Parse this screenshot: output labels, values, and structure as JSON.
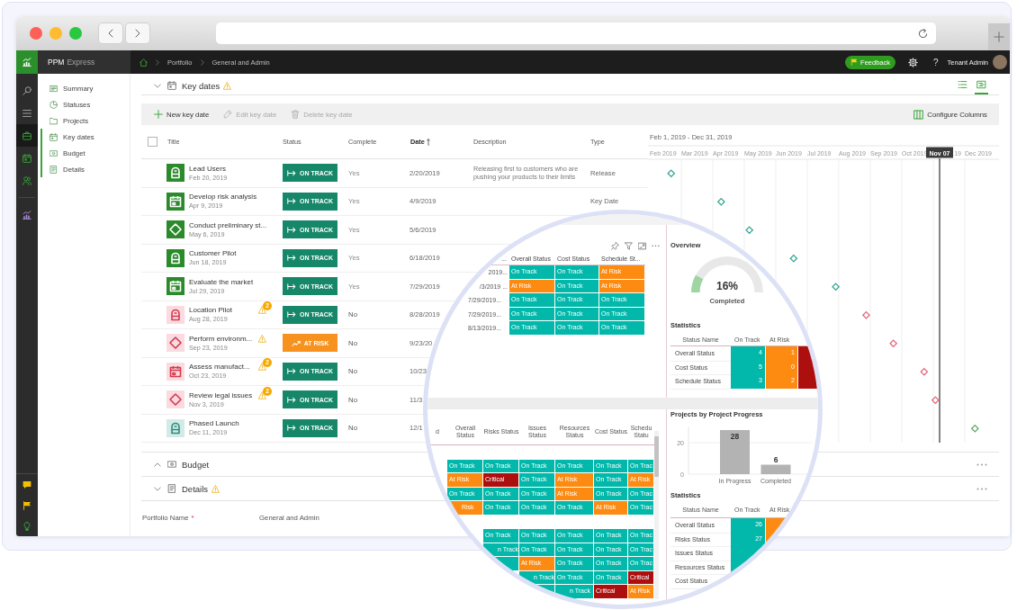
{
  "product": {
    "name": "PPM",
    "suffix": "Express"
  },
  "breadcrumb": [
    "Portfolio",
    "General and Admin"
  ],
  "header": {
    "feedback": "Feedback",
    "help": "?",
    "user": "Tenant Admin"
  },
  "rail": [
    {
      "kind": "search",
      "selected": false
    },
    {
      "kind": "menu",
      "selected": false
    },
    {
      "kind": "briefcase",
      "selected": true
    },
    {
      "kind": "calendar",
      "selected": false
    },
    {
      "kind": "person",
      "selected": false
    },
    {
      "kind": "chart",
      "selected": false
    }
  ],
  "rail_bottom": [
    {
      "kind": "chat"
    },
    {
      "kind": "flag"
    },
    {
      "kind": "bulb"
    }
  ],
  "nav": [
    {
      "kind": "summary",
      "label": "Summary",
      "in_view": false
    },
    {
      "kind": "statuses",
      "label": "Statuses",
      "in_view": false
    },
    {
      "kind": "projects",
      "label": "Projects",
      "in_view": false
    },
    {
      "kind": "keydates",
      "label": "Key dates",
      "in_view": true
    },
    {
      "kind": "budget",
      "label": "Budget",
      "in_view": true
    },
    {
      "kind": "details",
      "label": "Details",
      "in_view": true
    }
  ],
  "key_dates": {
    "title": "Key dates",
    "expanded": true,
    "warning": true,
    "views": [
      {
        "kind": "list",
        "selected": false
      },
      {
        "kind": "timeline",
        "selected": true
      }
    ],
    "toolbar": [
      {
        "kind": "add",
        "label": "New key date",
        "disabled": false
      },
      {
        "kind": "edit",
        "label": "Edit key date",
        "disabled": true
      },
      {
        "kind": "delete",
        "label": "Delete key date",
        "disabled": true
      }
    ],
    "configure": "Configure Columns",
    "select_all": {
      "checked": false
    },
    "columns": [
      {
        "label": "Title",
        "sorted": false
      },
      {
        "label": "Status",
        "sorted": false
      },
      {
        "label": "Complete",
        "sorted": false
      },
      {
        "label": "Date",
        "sorted": true
      },
      {
        "label": "Description",
        "sorted": false
      },
      {
        "label": "Type",
        "sorted": false
      }
    ],
    "rows": [
      {
        "kind": "gate",
        "done": true,
        "overdue": false,
        "title": "Lead Users",
        "subtitle": "Feb 20, 2019",
        "warning": false,
        "status": {
          "kind": "on_track",
          "label": "ON TRACK"
        },
        "complete": "Yes",
        "date": "2/20/2019",
        "description": "Releasing first to customers who are pushing your products to their limits",
        "type": "Release"
      },
      {
        "kind": "calendar",
        "done": true,
        "overdue": false,
        "title": "Develop risk analysis",
        "subtitle": "Apr 9, 2019",
        "warning": false,
        "status": {
          "kind": "on_track",
          "label": "ON TRACK"
        },
        "complete": "Yes",
        "date": "4/9/2019",
        "type": "Key Date"
      },
      {
        "kind": "diamond",
        "done": true,
        "overdue": false,
        "title": "Conduct preliminary st...",
        "subtitle": "May 6, 2019",
        "warning": false,
        "status": {
          "kind": "on_track",
          "label": "ON TRACK"
        },
        "complete": "Yes",
        "date": "5/6/2019"
      },
      {
        "kind": "gate",
        "done": true,
        "overdue": false,
        "title": "Customer Pilot",
        "subtitle": "Jun 18, 2019",
        "warning": false,
        "status": {
          "kind": "on_track",
          "label": "ON TRACK"
        },
        "complete": "Yes",
        "date": "6/18/2019"
      },
      {
        "kind": "calendar",
        "done": true,
        "overdue": false,
        "title": "Evaluate the market",
        "subtitle": "Jul 29, 2019",
        "warning": false,
        "status": {
          "kind": "on_track",
          "label": "ON TRACK"
        },
        "complete": "Yes",
        "date": "7/29/2019"
      },
      {
        "kind": "gate",
        "done": false,
        "overdue": true,
        "title": "Location Pilot",
        "subtitle": "Aug 28, 2019",
        "warning": true,
        "badge": "2",
        "status": {
          "kind": "on_track",
          "label": "ON TRACK"
        },
        "complete": "No",
        "date": "8/28/2019"
      },
      {
        "kind": "diamond",
        "done": false,
        "overdue": true,
        "title": "Perform environm...",
        "subtitle": "Sep 23, 2019",
        "warning": true,
        "status": {
          "kind": "at_risk",
          "label": "AT RISK"
        },
        "complete": "No",
        "date": "9/23/20"
      },
      {
        "kind": "calendar",
        "done": false,
        "overdue": true,
        "title": "Assess manufact...",
        "subtitle": "Oct 23, 2019",
        "warning": true,
        "badge": "2",
        "status": {
          "kind": "on_track",
          "label": "ON TRACK"
        },
        "complete": "No",
        "date": "10/23"
      },
      {
        "kind": "diamond",
        "done": false,
        "overdue": true,
        "title": "Review legal issues",
        "subtitle": "Nov 3, 2019",
        "warning": true,
        "badge": "2",
        "status": {
          "kind": "on_track",
          "label": "ON TRACK"
        },
        "complete": "No",
        "date": "11/3"
      },
      {
        "kind": "gate",
        "done": false,
        "overdue": false,
        "title": "Phased Launch",
        "subtitle": "Dec 11, 2019",
        "warning": false,
        "status": {
          "kind": "on_track",
          "label": "ON TRACK"
        },
        "complete": "No",
        "date": "12/1"
      }
    ],
    "timeline": {
      "range": "Feb 1, 2019 - Dec 31, 2019",
      "months": [
        "Feb 2019",
        "Mar 2019",
        "Apr 2019",
        "May 2019",
        "Jun 2019",
        "Jul 2019",
        "Aug 2019",
        "Sep 2019",
        "Oct 2019",
        "19",
        "Dec 2019"
      ],
      "today": "Nov 07"
    }
  },
  "budget": {
    "title": "Budget",
    "expanded": false,
    "warning": false
  },
  "details": {
    "title": "Details",
    "expanded": true,
    "warning": true,
    "fields": [
      {
        "label": "Portfolio Name",
        "required_mark": "*",
        "value": "General and Admin"
      }
    ]
  },
  "magnifier": {
    "top_table": {
      "columns": [
        "...",
        "Overall Status",
        "Cost Status",
        "Schedule St..."
      ],
      "rows": [
        {
          "cells": [
            {
              "label": "2019...",
              "clipped": true
            },
            {
              "kind": "on_track",
              "label": "On Track",
              "clipped": false
            },
            {
              "kind": "on_track",
              "label": "On Track",
              "clipped": false
            },
            {
              "kind": "at_risk",
              "label": "At Risk",
              "clipped": false
            }
          ]
        },
        {
          "cells": [
            {
              "label": "/3/2019 ...",
              "clipped": true
            },
            {
              "kind": "at_risk",
              "label": "At Risk",
              "clipped": false
            },
            {
              "kind": "on_track",
              "label": "On Track",
              "clipped": false
            },
            {
              "kind": "at_risk",
              "label": "At Risk",
              "clipped": false
            }
          ]
        },
        {
          "cells": [
            {
              "label": "7/29/2019...",
              "clipped": false
            },
            {
              "kind": "on_track",
              "label": "On Track",
              "clipped": false
            },
            {
              "kind": "on_track",
              "label": "On Track",
              "clipped": false
            },
            {
              "kind": "on_track",
              "label": "On Track",
              "clipped": false
            }
          ]
        },
        {
          "cells": [
            {
              "label": "7/29/2019...",
              "clipped": false
            },
            {
              "kind": "on_track",
              "label": "On Track",
              "clipped": false
            },
            {
              "kind": "on_track",
              "label": "On Track",
              "clipped": false
            },
            {
              "kind": "on_track",
              "label": "On Track",
              "clipped": false
            }
          ]
        },
        {
          "cells": [
            {
              "label": "8/13/2019...",
              "clipped": false
            },
            {
              "kind": "on_track",
              "label": "On Track",
              "clipped": false
            },
            {
              "kind": "on_track",
              "label": "On Track",
              "clipped": false
            },
            {
              "kind": "on_track",
              "label": "On Track",
              "clipped": false
            }
          ]
        }
      ]
    },
    "overview": {
      "title": "Overview",
      "level": 0.16,
      "value": "16%",
      "caption": "Completed"
    },
    "statistics": {
      "title": "Statistics",
      "columns": [
        "Status Name",
        "On Track",
        "At Risk"
      ],
      "rows": [
        {
          "cells": [
            {
              "label": "Overall Status"
            },
            {
              "kind": "on_track",
              "label": "4"
            },
            {
              "kind": "at_risk",
              "label": "1"
            },
            {
              "kind": "critical"
            }
          ]
        },
        {
          "cells": [
            {
              "label": "Cost Status"
            },
            {
              "kind": "on_track",
              "label": "5"
            },
            {
              "kind": "at_risk",
              "label": "0"
            },
            {
              "kind": "critical"
            }
          ]
        },
        {
          "cells": [
            {
              "label": "Schedule Status"
            },
            {
              "kind": "on_track",
              "label": "3"
            },
            {
              "kind": "at_risk",
              "label": "2"
            },
            {
              "kind": "critical"
            }
          ]
        }
      ]
    },
    "projects_table": {
      "columns": [
        "d",
        "Overall Status",
        "Risks Status",
        "Issues Status",
        "Resources Status",
        "Cost Status",
        "Schedu Statu"
      ],
      "rows": [
        {
          "kind": "spacer"
        },
        {
          "kind": "data",
          "cells": [
            null,
            {
              "kind": "on_track",
              "label": "On Track",
              "clipped": false
            },
            {
              "kind": "on_track",
              "label": "On Track",
              "clipped": false
            },
            {
              "kind": "on_track",
              "label": "On Track",
              "clipped": false
            },
            {
              "kind": "on_track",
              "label": "On Track",
              "clipped": false
            },
            {
              "kind": "on_track",
              "label": "On Track",
              "clipped": false
            },
            {
              "kind": "on_track",
              "label": "On Trac",
              "clipped": false
            }
          ]
        },
        {
          "kind": "data",
          "cells": [
            null,
            {
              "kind": "at_risk",
              "label": "At Risk",
              "clipped": false
            },
            {
              "kind": "critical",
              "label": "Critical",
              "clipped": false
            },
            {
              "kind": "on_track",
              "label": "On Track",
              "clipped": false
            },
            {
              "kind": "at_risk",
              "label": "At Risk",
              "clipped": false
            },
            {
              "kind": "on_track",
              "label": "On Track",
              "clipped": false
            },
            {
              "kind": "at_risk",
              "label": "At Risk",
              "clipped": false
            }
          ]
        },
        {
          "kind": "data",
          "cells": [
            null,
            {
              "kind": "on_track",
              "label": "On Track",
              "clipped": false
            },
            {
              "kind": "on_track",
              "label": "On Track",
              "clipped": false
            },
            {
              "kind": "on_track",
              "label": "On Track",
              "clipped": false
            },
            {
              "kind": "at_risk",
              "label": "At Risk",
              "clipped": false
            },
            {
              "kind": "on_track",
              "label": "On Track",
              "clipped": false
            },
            {
              "kind": "on_track",
              "label": "On Trac",
              "clipped": false
            }
          ]
        },
        {
          "kind": "data",
          "cells": [
            null,
            {
              "kind": "at_risk",
              "label": "Risk",
              "clipped": true
            },
            {
              "kind": "on_track",
              "label": "On Track",
              "clipped": false
            },
            {
              "kind": "on_track",
              "label": "On Track",
              "clipped": false
            },
            {
              "kind": "on_track",
              "label": "On Track",
              "clipped": false
            },
            {
              "kind": "at_risk",
              "label": "At Risk",
              "clipped": false
            },
            {
              "kind": "on_track",
              "label": "On Trac",
              "clipped": false
            }
          ]
        },
        {
          "kind": "spacer"
        },
        {
          "kind": "data",
          "cells": [
            null,
            null,
            {
              "kind": "on_track",
              "label": "On Track",
              "clipped": false
            },
            {
              "kind": "on_track",
              "label": "On Track",
              "clipped": false
            },
            {
              "kind": "on_track",
              "label": "On Track",
              "clipped": false
            },
            {
              "kind": "on_track",
              "label": "On Track",
              "clipped": false
            },
            {
              "kind": "on_track",
              "label": "On Trac",
              "clipped": false
            }
          ]
        },
        {
          "kind": "data",
          "cells": [
            null,
            null,
            {
              "kind": "on_track",
              "label": "n Track",
              "clipped": true
            },
            {
              "kind": "on_track",
              "label": "On Track",
              "clipped": false
            },
            {
              "kind": "on_track",
              "label": "On Track",
              "clipped": false
            },
            {
              "kind": "on_track",
              "label": "On Track",
              "clipped": false
            },
            {
              "kind": "on_track",
              "label": "On Trac",
              "clipped": false
            }
          ]
        },
        {
          "kind": "data",
          "cells": [
            null,
            null,
            {
              "kind": "on_track"
            },
            {
              "kind": "at_risk",
              "label": "At Risk",
              "clipped": false
            },
            {
              "kind": "on_track",
              "label": "On Track",
              "clipped": false
            },
            {
              "kind": "on_track",
              "label": "On Track",
              "clipped": false
            },
            {
              "kind": "on_track",
              "label": "On Trac",
              "clipped": false
            }
          ]
        },
        {
          "kind": "data",
          "cells": [
            null,
            null,
            null,
            {
              "kind": "on_track",
              "label": "n Track",
              "clipped": true
            },
            {
              "kind": "on_track",
              "label": "On Track",
              "clipped": false
            },
            {
              "kind": "on_track",
              "label": "On Track",
              "clipped": false
            },
            {
              "kind": "critical",
              "label": "Critical",
              "clipped": false
            }
          ]
        },
        {
          "kind": "data",
          "cells": [
            null,
            null,
            null,
            {
              "kind": "on_track"
            },
            {
              "kind": "on_track",
              "label": "n Track",
              "clipped": true
            },
            {
              "kind": "critical",
              "label": "Critical",
              "clipped": false
            },
            {
              "kind": "at_risk",
              "label": "At Risk",
              "clipped": false
            }
          ]
        }
      ]
    },
    "progress": {
      "title": "Projects by Project Progress",
      "chart_data": {
        "type": "bar",
        "categories": [
          "In Progress",
          "Completed"
        ],
        "values": [
          28,
          6
        ],
        "ylim": [
          0,
          30
        ],
        "yticks": [
          0,
          20
        ],
        "data_labels": true
      }
    },
    "project_statistics": {
      "title": "Statistics",
      "columns": [
        "Status Name",
        "On Track",
        "At Risk"
      ],
      "rows": [
        {
          "cells": [
            {
              "label": "Overall Status"
            },
            {
              "kind": "on_track",
              "label": "26"
            },
            {
              "kind": "at_risk"
            }
          ]
        },
        {
          "cells": [
            {
              "label": "Risks Status"
            },
            {
              "kind": "on_track",
              "label": "27"
            },
            {
              "kind": "at_risk"
            }
          ]
        },
        {
          "cells": [
            {
              "label": "Issues Status"
            },
            {
              "kind": "on_track"
            }
          ]
        },
        {
          "cells": [
            {
              "label": "Resources Status"
            },
            {
              "kind": "on_track"
            }
          ]
        },
        {
          "cells": [
            {
              "label": "Cost Status"
            }
          ]
        }
      ]
    }
  }
}
